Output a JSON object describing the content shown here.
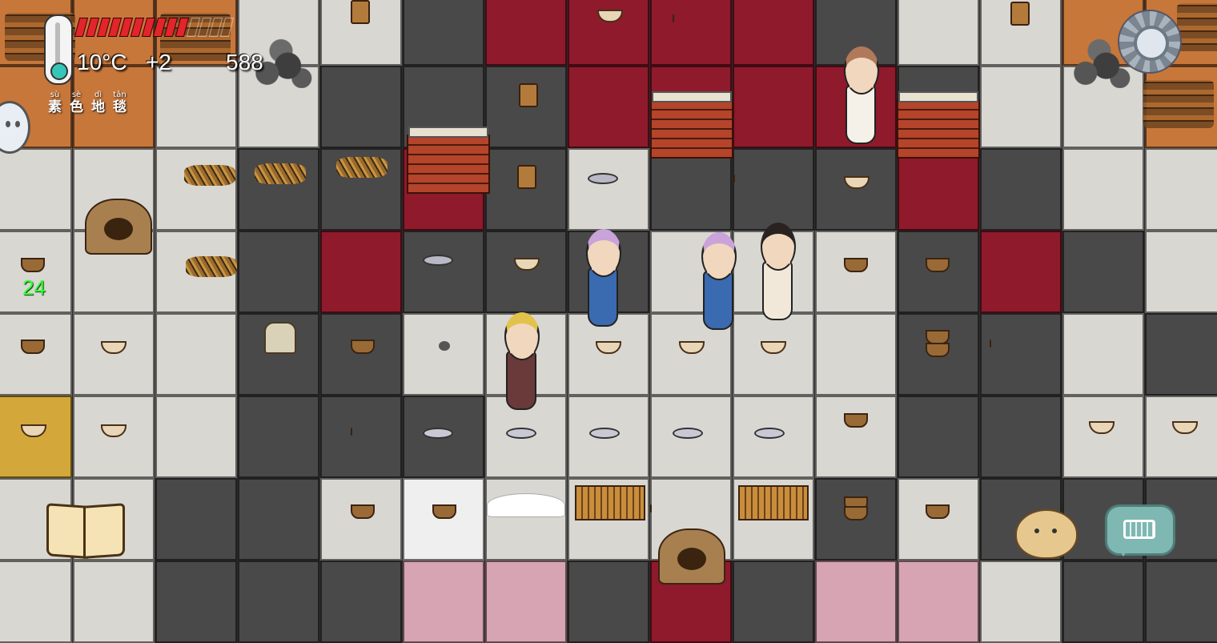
{
  "hud": {
    "temperature": "10°C",
    "temp_modifier": "+2",
    "yum_counter": "588",
    "food_pips_full": 10,
    "food_pips_total": 14,
    "tile_label": [
      {
        "pinyin": "sù",
        "hanzi": "素"
      },
      {
        "pinyin": "sè",
        "hanzi": "色"
      },
      {
        "pinyin": "dì",
        "hanzi": "地"
      },
      {
        "pinyin": "tǎn",
        "hanzi": "毯"
      }
    ],
    "green_number": "24"
  },
  "icons": {
    "thermometer": "thermometer-icon",
    "settings": "gear-icon",
    "recipe_book": "open-book-icon",
    "emote": "potato-face-icon",
    "chat": "keyboard-chat-icon",
    "side_menu": "face-bubble-icon"
  },
  "colors": {
    "food_pip": "#e3242b",
    "thermo_bulb": "#36c6b8",
    "green_number": "#37ff3a",
    "rug_red": "#8e1a2c",
    "rug_white": "#d9d7d2",
    "rug_dark": "#4a4949",
    "rug_pink": "#d7a4b3"
  }
}
